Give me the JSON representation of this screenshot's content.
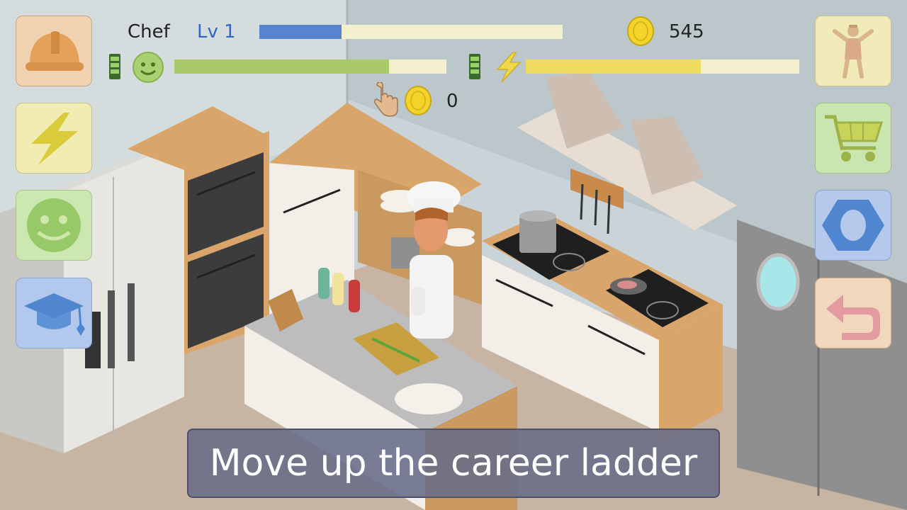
{
  "hud": {
    "job_title": "Chef",
    "level_label": "Lv 1",
    "xp_progress": 0.27,
    "coins": "545",
    "mood_progress": 0.79,
    "energy_progress": 0.64,
    "tap_coins": "0"
  },
  "left_menu": {
    "job_icon": "hard-hat-icon",
    "energy_icon": "lightning-icon",
    "mood_icon": "smiley-icon",
    "education_icon": "graduation-cap-icon"
  },
  "right_menu": {
    "character_icon": "character-icon",
    "shop_icon": "shopping-cart-icon",
    "settings_icon": "hex-nut-icon",
    "back_icon": "back-arrow-icon"
  },
  "caption": "Move up the career ladder",
  "colors": {
    "xp_bar": "#5784cc",
    "mood_bar": "#a9c96a",
    "energy_bar": "#f0dd60",
    "bar_track": "#f3efcf",
    "coin": "#f2d42a",
    "caption_bg": "#676c88"
  }
}
